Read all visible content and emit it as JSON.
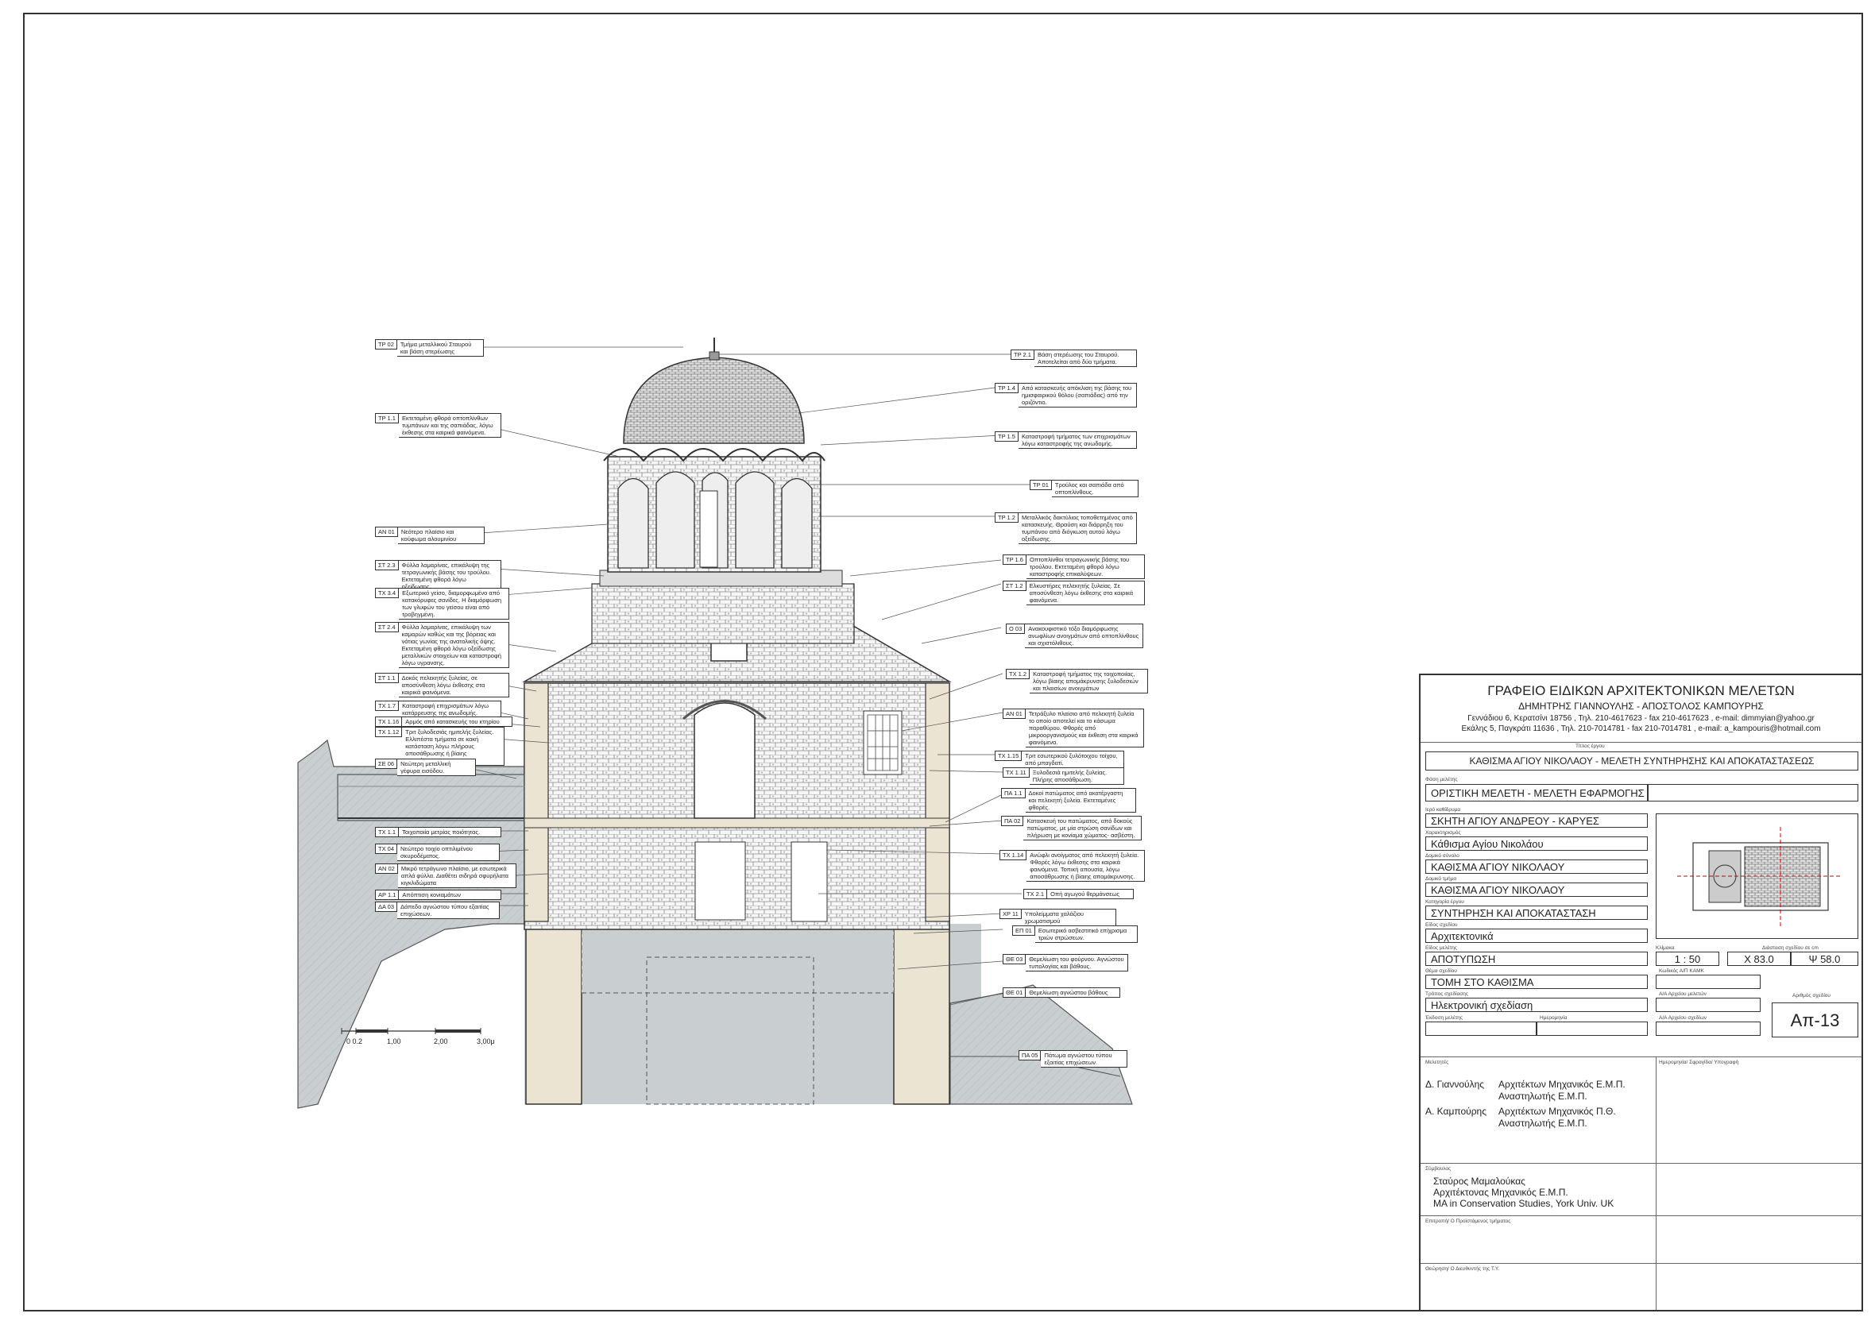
{
  "annotations_left": [
    {
      "code": "ΤΡ 02",
      "text": "Τμήμα μεταλλικού Σταυρού και βάση στερέωσης"
    },
    {
      "code": "ΤΡ 1.1",
      "text": "Εκτεταμένη φθορά οπτοπλίνθων τυμπάνων και της σαπιάδας, λόγω έκθεσης στα καιρικά φαινόμενα."
    },
    {
      "code": "ΑΝ 01",
      "text": "Νεότερο πλαίσιο και κούφωμα αλουμινίου"
    },
    {
      "code": "ΣΤ 2.3",
      "text": "Φύλλα λαμαρίνας, επικάλυψη της τετραγωνικής βάσης του τρούλου. Εκτεταμένη φθορά λόγω οξείδωσης."
    },
    {
      "code": "ΤΧ 3.4",
      "text": "Εξωτερικό γείσο, διαμορφωμένο από κατακόρυφες σανίδες. Η διαμόρφωση των γλυφών του γείσου είναι από τροβηγμένη."
    },
    {
      "code": "ΣΤ 2.4",
      "text": "Φύλλα λαμαρίνας, επικάλυψη των καμαρών καθώς και της βόρειας και νότιας γωνίας της ανατολικής όψης. Εκτεταμένη φθορά λόγω οξείδωσης μεταλλικών στοιχείων και καταστροφή λόγω υγρανσης."
    },
    {
      "code": "ΣΤ 1.1",
      "text": "Δοκός πελεκητής ξυλείας, σε αποσύνθεση λόγω έκθεσης στα καιρικά φαινόμενα."
    },
    {
      "code": "ΤΧ 1.7",
      "text": "Καταστροφή επιχρισμάτων λόγω κατάρρευσης της ανωδομής."
    },
    {
      "code": "ΤΧ 1.16",
      "text": "Αρμός από κατασκευής του κτηρίου"
    },
    {
      "code": "ΤΧ 1.12",
      "text": "Τριτ ξυλοδεσιάς ημιτελής ξυλείας. Ελλιπέστα τμήματα σε κακή κατάσταση λόγω πλήρους αποσάθρωσης ή βίαιης απομάκρυνσης."
    },
    {
      "code": "ΣΕ 06",
      "text": "Νεώτερη μεταλλική γέφυρα εισόδου."
    },
    {
      "code": "ΤΧ 1.1",
      "text": "Τοιχοποιία μετρίας ποιότητας."
    },
    {
      "code": "ΤΧ 04",
      "text": "Νεώτερο τοιχίο οπτιλιμένου σκυροδέματος."
    },
    {
      "code": "ΑΝ 02",
      "text": "Μικρό τετράγωνο πλαίσιο, με εσωτερικά απλά φύλλα. Διαθέτει σιδηρά σφυρήλατα κιγκλιδώματα"
    },
    {
      "code": "ΑΡ 1.1",
      "text": "Απόπτιση κονιαμάτων"
    },
    {
      "code": "ΔΑ 03",
      "text": "Δάπεδο αγνώστου τύπου εξαιτίας επιχώσεων."
    }
  ],
  "annotations_right": [
    {
      "code": "ΤΡ 2.1",
      "text": "Βάση στερέωσης του Σταυρού. Αποτελείται από δύο τμήματα."
    },
    {
      "code": "ΤΡ 1.4",
      "text": "Από κατασκευής απόκλιση της βάσης του ημισφαιρικού θόλου (σαπιάδας) από την οριζόντιο."
    },
    {
      "code": "ΤΡ 1.5",
      "text": "Καταστροφή τμήματος των επιχρισμάτων λόγω καταστροφής της ανωδομής."
    },
    {
      "code": "ΤΡ 01",
      "text": "Τρούλος και σαπιάδα από οπτοπλίνθους."
    },
    {
      "code": "ΤΡ 1.2",
      "text": "Μεταλλικός δακτύλιος τοποθετημένος από κατασκευής. Θραύση και διάρρηξη του τυμπάνου από διόγκωση αυτού λόγω οξείδωσης."
    },
    {
      "code": "ΤΡ 1.6",
      "text": "Οπτοπλίνθοι τετραγωνικής βάσης του τρούλου. Εκτεταμένη φθορά λόγω καταστροφής επικαλύψεων."
    },
    {
      "code": "ΣΤ 1.2",
      "text": "Ελκυστήρες πελεκητής ξυλείας. Σε αποσύνθεση λόγω έκθεσης στα καιρικά φαινόμενα."
    },
    {
      "code": "Ο 03",
      "text": "Ανακουφιστικό τόξο διαμόρφωσης ανωφλίων ανοιγμάτων από οπτοπλίνθους και σχιστόλιθους."
    },
    {
      "code": "ΤΧ 1.2",
      "text": "Καταστροφή τμήματος της τοιχοποιίας, λόγω βίαιης απομάκρυνσης ξυλοδεσιών και πλαισίων ανοιγμάτων"
    },
    {
      "code": "ΑΝ 01",
      "text": "Τετράξυλο πλαίσιο από πελεκητή ξυλεία το οποίο αποτελεί και το κάσωμα παραθύρου. Φθορές από μικροοργανισμούς και έκθεση στα καιρικά φαινόμενα."
    },
    {
      "code": "ΤΧ 1.15",
      "text": "Τριτ εσωτερικού ξυλότοιχου τοίχου, από μπαγδατί."
    },
    {
      "code": "ΤΧ 1.11",
      "text": "Ξυλοδεσιά ημιτελής ξυλείας. Πλήρης αποσάθρωση."
    },
    {
      "code": "ΠΑ 1.1",
      "text": "Δοκοί πατώματος από ακατέργαστη και πελεκητή ξυλεία. Εκτεταμένες φθορές."
    },
    {
      "code": "ΠΑ 02",
      "text": "Κατασκευή του πατώματος, από δοκούς πατώματος, με μία στρώση σανίδων και πλήρωση με κονίαμα χώματος- ασβέστη."
    },
    {
      "code": "ΤΧ 1.14",
      "text": "Ανώφλι ανοίγματος από πελεκητή ξυλεία. Φθορές λόγω έκθεσης στα καιρικά φαινόμενα. Τοπική απουσία, λόγω αποσάθρωσης ή βίαιης απομάκρυνσης."
    },
    {
      "code": "ΤΧ 2.1",
      "text": "Οπή αγωγού θερμάνσεως"
    },
    {
      "code": "ΧΡ 11",
      "text": "Υπολείμματα χαλάζιου χρωματισμού"
    },
    {
      "code": "ΕΠ 01",
      "text": "Εσωτερικό ασβεστιτικό επίχρισμα τριών στρώσεων."
    },
    {
      "code": "ΘΕ 03",
      "text": "Θεμελίωση του φούρνου. Αγνώστου τυπολογίας και βάθους."
    },
    {
      "code": "ΘΕ 01",
      "text": "Θεμελίωση αγνώστου βάθους"
    },
    {
      "code": "ΠΑ 05",
      "text": "Πάτωμα αγνώστου τύπου εξαιτίας επιχώσεων."
    }
  ],
  "scale_bar": {
    "labels": [
      "0 0.2",
      "1,00",
      "2,00",
      "3,00μ"
    ]
  },
  "title_block": {
    "office": "ΓΡΑΦΕΙΟ ΕΙΔΙΚΩΝ ΑΡΧΙΤΕΚΤΟΝΙΚΩΝ ΜΕΛΕΤΩΝ",
    "principals": "ΔΗΜΗΤΡΗΣ ΓΙΑΝΝΟΥΛΗΣ  -  ΑΠΟΣΤΟΛΟΣ ΚΑΜΠΟΥΡΗΣ",
    "address1": "Γεννάδιου 6, Κερατσίνι 18756 , Τηλ. 210-4617623 - fax 210-4617623 , e-mail: dimmyian@yahoo.gr",
    "address2": "Εκάλης 5, Παγκράτι 11636 , Τηλ. 210-7014781 - fax 210-7014781 , e-mail: a_kampouris@hotmail.com",
    "project_label": "Τίτλος έργου",
    "project": "ΚΑΘΙΣΜΑ ΑΓΙΟΥ ΝΙΚΟΛΑΟΥ - ΜΕΛΕΤΗ ΣΥΝΤΗΡΗΣΗΣ ΚΑΙ ΑΠΟΚΑΤΑΣΤΑΣΕΩΣ",
    "phase_label": "Φάση μελέτης",
    "phase": "ΟΡΙΣΤΙΚΗ ΜΕΛΕΤΗ - ΜΕΛΕΤΗ ΕΦΑΡΜΟΓΗΣ",
    "f1_label": "Ιερό καθίδρυμα",
    "f1": "ΣΚΗΤΗ ΑΓΙΟΥ ΑΝΔΡΕΟΥ - ΚΑΡΥΕΣ",
    "f2_label": "Χαρακτηρισμός",
    "f2": "Κάθισμα Αγίου Νικολάου",
    "f3_label": "Δομικό σύνολο",
    "f3": "ΚΑΘΙΣΜΑ ΑΓΙΟΥ ΝΙΚΟΛΑΟΥ",
    "f4_label": "Δομικό τμήμα",
    "f4": "ΚΑΘΙΣΜΑ ΑΓΙΟΥ ΝΙΚΟΛΑΟΥ",
    "f5_label": "Κατηγορία έργου",
    "f5": "ΣΥΝΤΗΡΗΣΗ ΚΑΙ ΑΠΟΚΑΤΑΣΤΑΣΗ",
    "f6_label": "Είδος σχεδίου",
    "f6": "Αρχιτεκτονικά",
    "f7_label": "Είδος μελέτης",
    "f7": "ΑΠΟΤΥΠΩΣΗ",
    "scale_label": "Κλίμακα",
    "scale": "1 : 50",
    "dims_label": "Διάσταση σχεδίου σε cm",
    "dim_x": "X  83.0",
    "dim_y": "Ψ  58.0",
    "f8_label": "Θέμα σχεδίου",
    "f8": "ΤΟΜΗ ΣΤΟ ΚΑΘΙΣΜΑ",
    "f9_label": "Τρόπος σχεδίασης",
    "f9": "Ηλεκτρονική σχεδίαση",
    "code_label": "Κωδικός Α/Π ΚΑΜΚ",
    "num_label": "Αριθμός σχεδίου",
    "drawing_no": "Απ-13",
    "file_label": "Α/Α Αρχείου μελετών",
    "file2_label": "Α/Α Αρχείου σχεδίων",
    "edition_label": "Έκδοση μελέτης",
    "dates_label": "Ημερομηνία",
    "designers_label": "Μελετητές",
    "sign_label": "Ημερομηνία/ Σφραγίδα/ Υπογραφή",
    "d1_name": "Δ. Γιαννούλης",
    "d1_role1": "Αρχιτέκτων Μηχανικός Ε.Μ.Π.",
    "d1_role2": "Αναστηλωτής Ε.Μ.Π.",
    "d2_name": "Α. Καμπούρης",
    "d2_role1": "Αρχιτέκτων Μηχανικός Π.Θ.",
    "d2_role2": "Αναστηλωτής Ε.Μ.Π.",
    "advisor_label": "Σύμβουλος",
    "advisor1": "Σταύρος  Μαμαλούκας",
    "advisor2": "Αρχιτέκτονας Μηχανικός Ε.Μ.Π.",
    "advisor3": "MA in Conservation Studies, York Univ. UK",
    "supervisor1_label": "Επιτροπή/ Ο Προϊστάμενος τμήματος",
    "supervisor2_label": "Θεώρηση/ Ο Διευθυντής της Τ.Υ."
  },
  "colors": {
    "section": "#ece4d2",
    "hatch": "#bcc2c4",
    "line": "#333333"
  }
}
